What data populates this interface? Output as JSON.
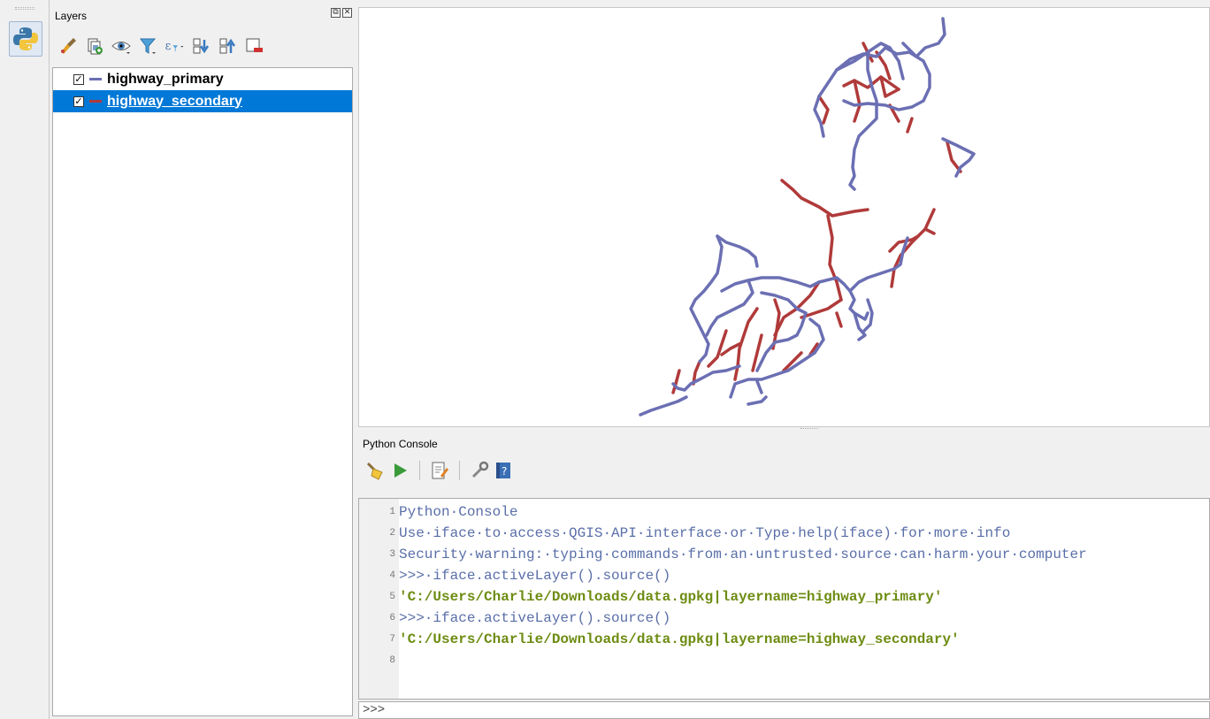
{
  "layers_panel": {
    "title": "Layers",
    "float_icon": "⧉",
    "close_icon": "✕",
    "toolbar_icons": [
      "style-manager-icon",
      "add-group-icon",
      "visibility-icon",
      "filter-icon",
      "expression-filter-icon",
      "expand-all-icon",
      "collapse-all-icon",
      "remove-layer-icon"
    ],
    "layers": [
      {
        "name": "highway_primary",
        "checked": "✓",
        "color": "#6b6fb3",
        "selected": false
      },
      {
        "name": "highway_secondary",
        "checked": "✓",
        "color": "#b03a3a",
        "selected": true
      }
    ]
  },
  "console": {
    "title": "Python Console",
    "prompt": ">>>",
    "lines": [
      {
        "num": "1",
        "text": "Python·Console",
        "kind": "info"
      },
      {
        "num": "2",
        "text": "Use·iface·to·access·QGIS·API·interface·or·Type·help(iface)·for·more·info",
        "kind": "info"
      },
      {
        "num": "3",
        "text": "Security·warning:·typing·commands·from·an·untrusted·source·can·harm·your·computer",
        "kind": "info"
      },
      {
        "num": "4",
        "text": ">>>·iface.activeLayer().source()",
        "kind": "info"
      },
      {
        "num": "5",
        "text": "'C:/Users/Charlie/Downloads/data.gpkg|layername=highway_primary'",
        "kind": "result"
      },
      {
        "num": "6",
        "text": ">>>·iface.activeLayer().source()",
        "kind": "info"
      },
      {
        "num": "7",
        "text": "'C:/Users/Charlie/Downloads/data.gpkg|layername=highway_secondary'",
        "kind": "result"
      },
      {
        "num": "8",
        "text": "",
        "kind": "info"
      }
    ]
  },
  "colors": {
    "primary_road": "#6b6fb3",
    "secondary_road": "#b03a3a",
    "selection": "#0078d7"
  }
}
